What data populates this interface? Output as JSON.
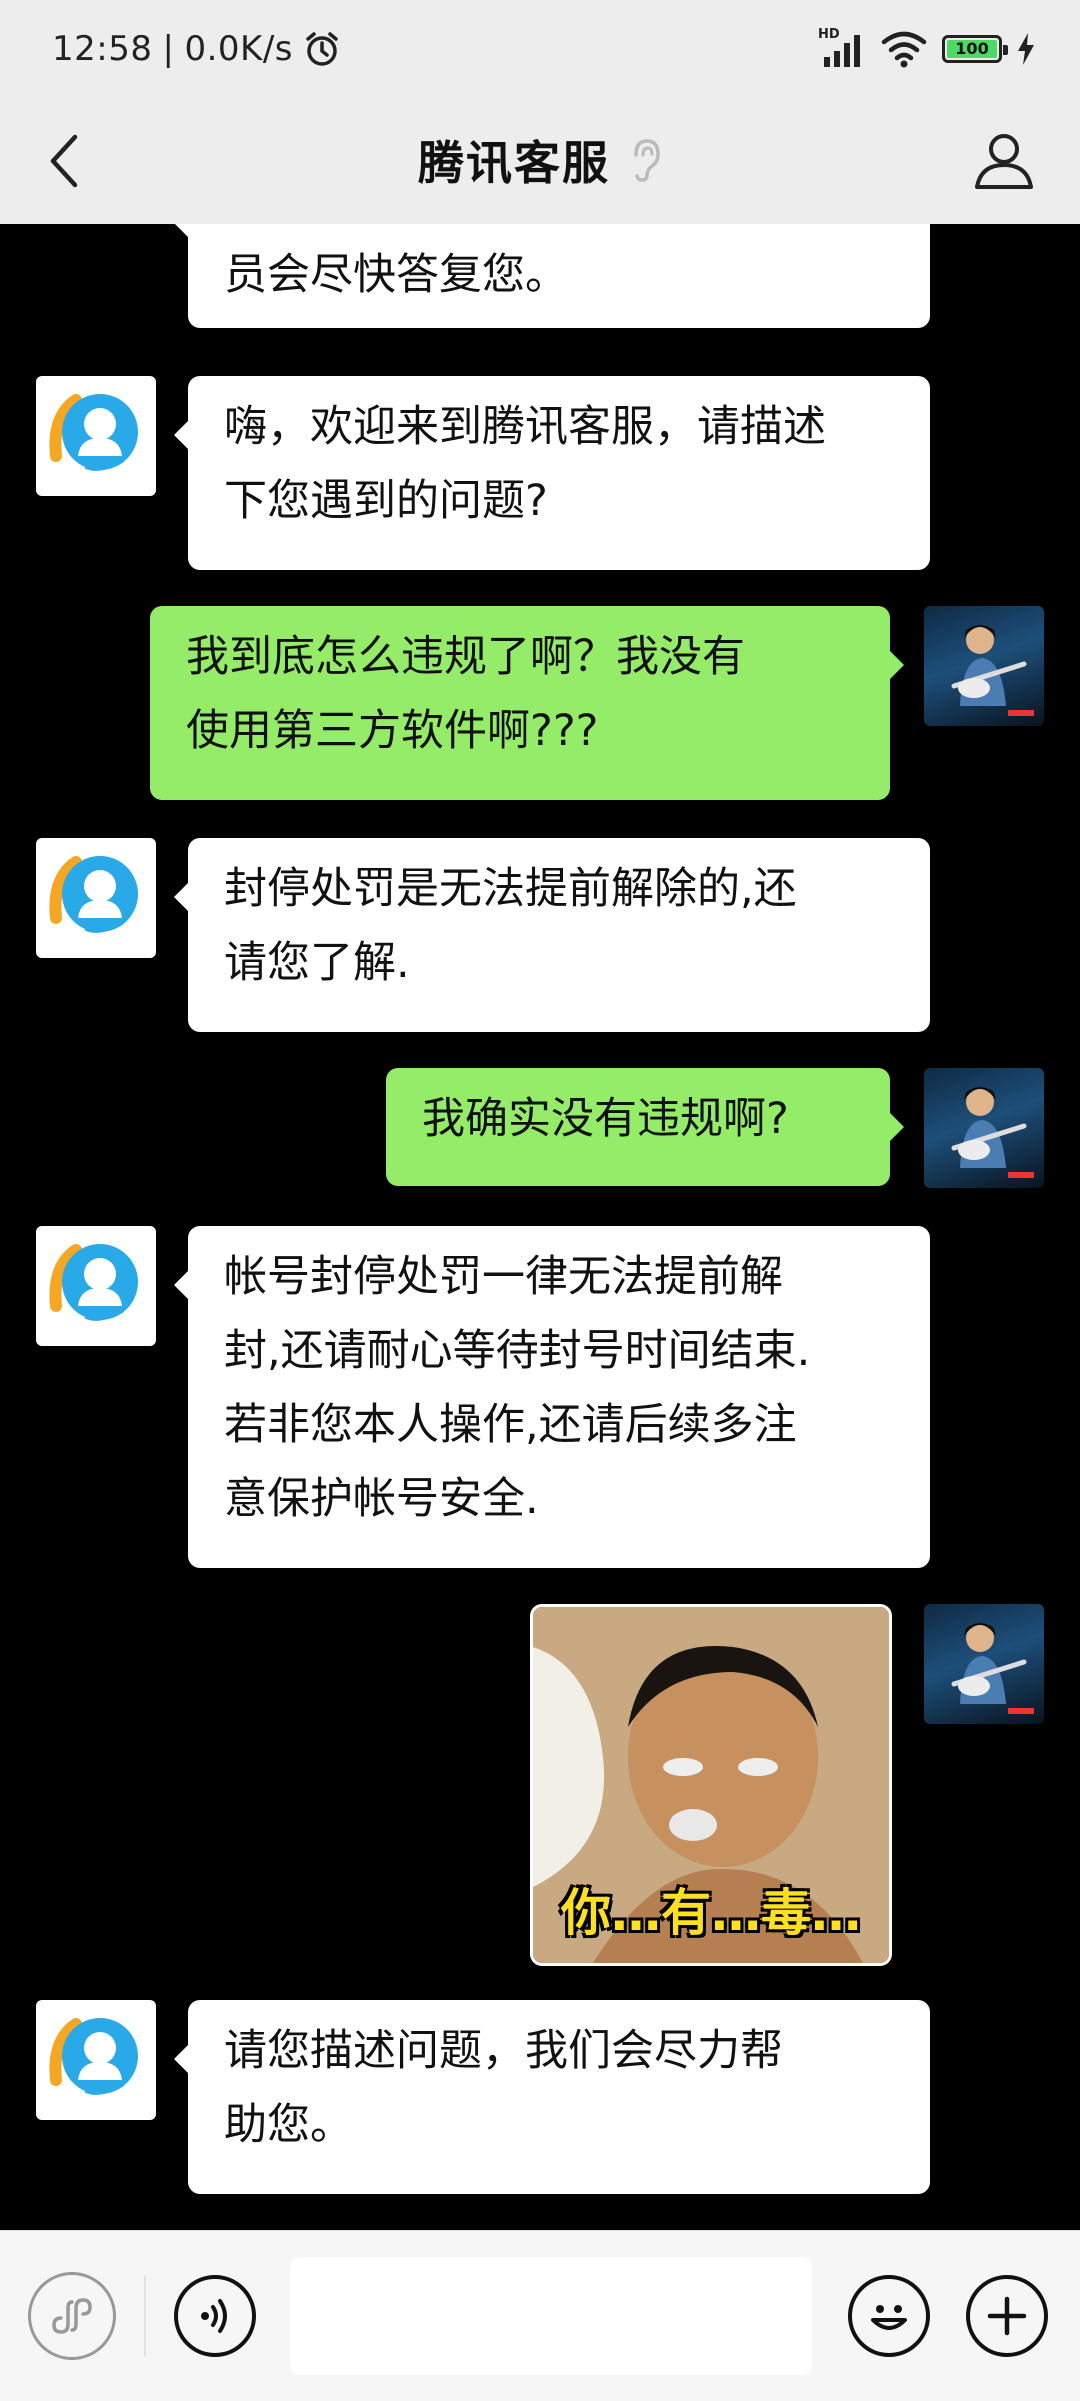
{
  "status_bar": {
    "time": "12:58",
    "speed": "0.0K/s",
    "battery": "100",
    "network_label": "HD"
  },
  "header": {
    "title": "腾讯客服",
    "icons": {
      "back": "chevron-left-icon",
      "ear": "ear-icon",
      "profile": "person-icon"
    }
  },
  "messages": [
    {
      "side": "left",
      "lines": [
        "员会尽快答复您。"
      ]
    },
    {
      "side": "left",
      "lines": [
        "嗨，欢迎来到腾讯客服，请描述",
        "下您遇到的问题?"
      ]
    },
    {
      "side": "right",
      "lines": [
        "我到底怎么违规了啊？我没有",
        "使用第三方软件啊???"
      ]
    },
    {
      "side": "left",
      "lines": [
        "封停处罚是无法提前解除的,还",
        "请您了解."
      ]
    },
    {
      "side": "right",
      "lines": [
        "我确实没有违规啊?"
      ]
    },
    {
      "side": "left",
      "lines": [
        "帐号封停处罚一律无法提前解",
        "封,还请耐心等待封号时间结束.",
        "若非您本人操作,还请后续多注",
        "意保护帐号安全."
      ]
    },
    {
      "side": "right",
      "type": "sticker",
      "caption": "你…有…毒…"
    },
    {
      "side": "left",
      "lines": [
        "请您描述问题，我们会尽力帮",
        "助您。"
      ]
    }
  ],
  "input_bar": {
    "text_value": "",
    "icons": [
      "mini-program-icon",
      "voice-icon",
      "emoji-icon",
      "plus-icon"
    ]
  },
  "colors": {
    "chat_background": "#000000",
    "incoming_bubble": "#ffffff",
    "outgoing_bubble": "#95ec69",
    "bar_background": "#ededed"
  }
}
